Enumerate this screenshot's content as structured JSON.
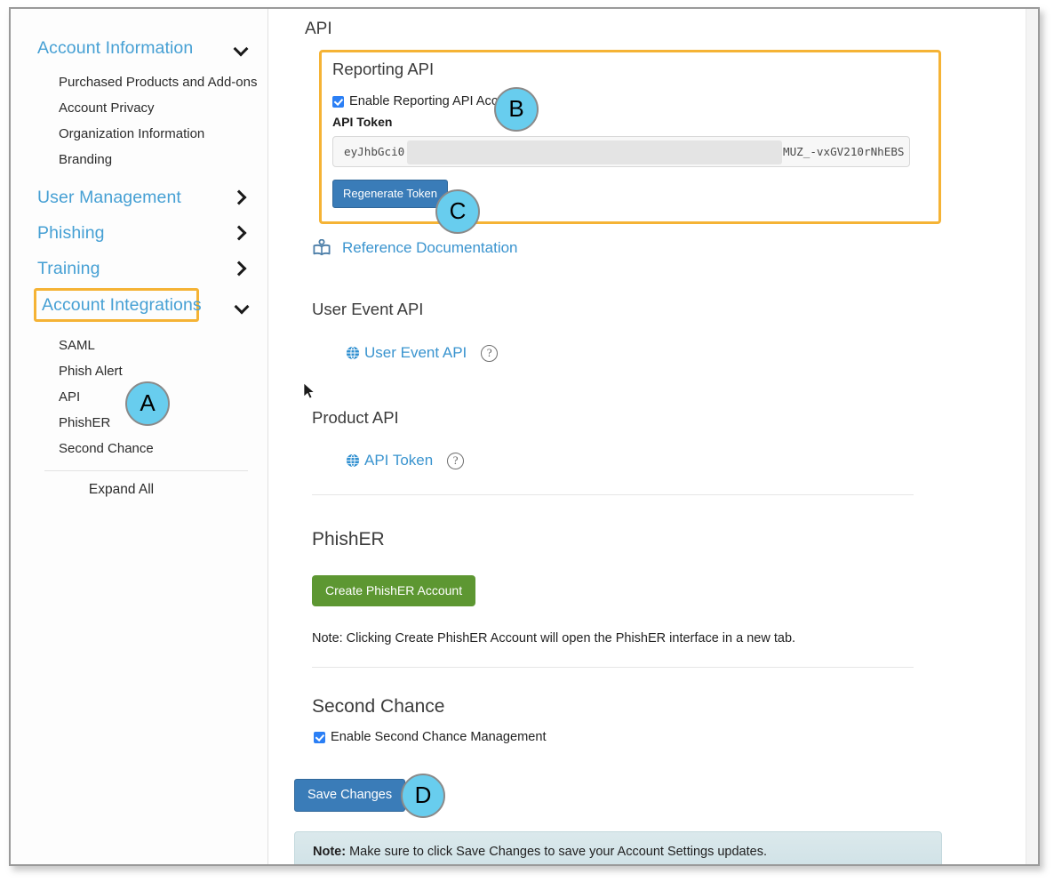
{
  "sidebar": {
    "groups": [
      {
        "label": "Account Information",
        "chevron": "chevron-down-icon",
        "expanded": true,
        "highlighted": false,
        "items": [
          "Purchased Products and Add-ons",
          "Account Privacy",
          "Organization Information",
          "Branding"
        ]
      },
      {
        "label": "User Management",
        "chevron": "chevron-right-icon",
        "expanded": false,
        "highlighted": false,
        "items": []
      },
      {
        "label": "Phishing",
        "chevron": "chevron-right-icon",
        "expanded": false,
        "highlighted": false,
        "items": []
      },
      {
        "label": "Training",
        "chevron": "chevron-right-icon",
        "expanded": false,
        "highlighted": false,
        "items": []
      },
      {
        "label": "Account Integrations",
        "chevron": "chevron-down-icon",
        "expanded": true,
        "highlighted": true,
        "items": [
          "SAML",
          "Phish Alert",
          "API",
          "PhishER",
          "Second Chance"
        ]
      }
    ],
    "expand_all_label": "Expand All"
  },
  "main": {
    "page_title": "API",
    "reporting_api": {
      "section_title": "Reporting API",
      "enable_checkbox_label": "Enable Reporting API Access",
      "enable_checkbox_checked": true,
      "token_label": "API Token",
      "token_value_start": "eyJhbGci0",
      "token_value_end": "MUZ_-vxGV210rNhEBS",
      "token_redacted": true,
      "regenerate_button_label": "Regenerate Token"
    },
    "reference_documentation_link": "Reference Documentation",
    "user_event_api": {
      "heading": "User Event API",
      "link_label": "User Event API",
      "help_glyph": "?"
    },
    "product_api": {
      "heading": "Product API",
      "link_label": "API Token",
      "help_glyph": "?"
    },
    "phisher": {
      "heading": "PhishER",
      "button_label": "Create PhishER Account",
      "note": "Note: Clicking Create PhishER Account will open the PhishER interface in a new tab."
    },
    "second_chance": {
      "heading": "Second Chance",
      "checkbox_label": "Enable Second Chance Management",
      "checkbox_checked": true
    },
    "save_changes_label": "Save Changes",
    "bottom_note": {
      "prefix": "Note:",
      "text": " Make sure to click Save Changes to save your Account Settings updates."
    }
  },
  "callouts": [
    {
      "id": "A",
      "label": "A"
    },
    {
      "id": "B",
      "label": "B"
    },
    {
      "id": "C",
      "label": "C"
    },
    {
      "id": "D",
      "label": "D"
    }
  ],
  "colors": {
    "accent_orange": "#f5b335",
    "link_blue": "#3a94cf",
    "nav_blue": "#46a0d4",
    "primary_button": "#3a7cb8",
    "success_button": "#5d9732",
    "callout_fill": "#68cdee",
    "note_banner": "#d9e9ec"
  }
}
